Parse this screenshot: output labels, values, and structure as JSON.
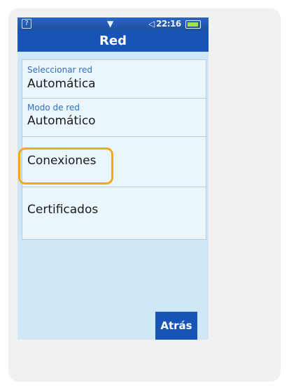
{
  "status_bar": {
    "help_symbol": "?",
    "notification_symbol": "▼",
    "volume_symbol": "◁",
    "time": "22:16",
    "battery_icon": "battery-icon"
  },
  "screen": {
    "title": "Red"
  },
  "menu": {
    "items": [
      {
        "sub": "Seleccionar red",
        "value": "Automática"
      },
      {
        "sub": "Modo de red",
        "value": "Automático"
      },
      {
        "label": "Conexiones"
      },
      {
        "label": "Certificados"
      }
    ]
  },
  "softkey": {
    "back_label": "Atrás"
  },
  "colors": {
    "accent": "#1754b6",
    "highlight": "#f2aa1a",
    "background": "#cfe7f6"
  }
}
